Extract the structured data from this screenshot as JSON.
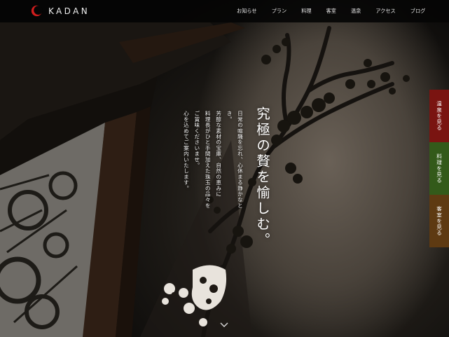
{
  "header": {
    "logo_text": "KADAN",
    "logo_icon": "red-crescent-logo",
    "nav": [
      {
        "label": "お知らせ"
      },
      {
        "label": "プラン"
      },
      {
        "label": "料理"
      },
      {
        "label": "客室"
      },
      {
        "label": "温泉"
      },
      {
        "label": "アクセス"
      },
      {
        "label": "ブログ"
      }
    ]
  },
  "hero": {
    "catch_copy": "究極の贅を愉しむ。",
    "body_lines": [
      "日常の喧騒を忘れ、心休まる静かなとき。",
      "芳醇な素材の宝庫、自然の恵みに",
      "料理長がひと手間加えた珠玉の品々を",
      "ご賞味くださいませ。",
      "心を込めてご案内いたします。"
    ],
    "scroll_icon": "chevron-down-icon"
  },
  "side_tabs": [
    {
      "label": "温泉を見る",
      "color": "#7a1411"
    },
    {
      "label": "料理を見る",
      "color": "#335a1a"
    },
    {
      "label": "客室を見る",
      "color": "#5e3a12"
    }
  ],
  "colors": {
    "header_bg": "#050505",
    "brand_red": "#d21d1d"
  }
}
